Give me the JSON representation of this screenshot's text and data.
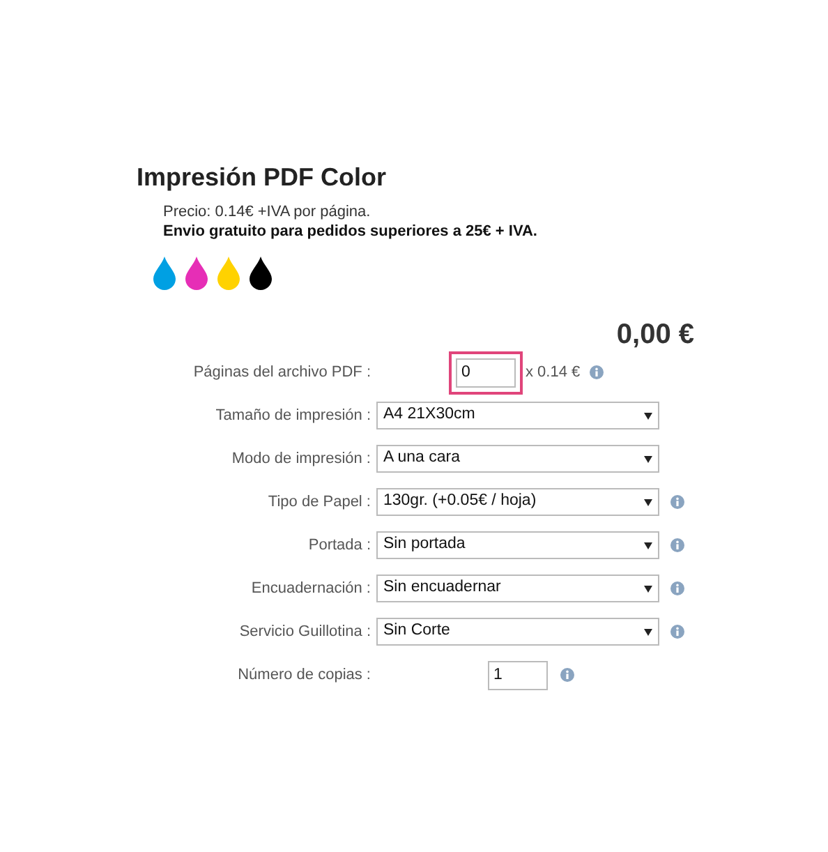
{
  "product": {
    "title": "Impresión PDF Color",
    "price_note": "Precio: 0.14€ +IVA por página.",
    "shipping_note": "Envio gratuito para pedidos superiores a 25€ + IVA.",
    "inks": [
      {
        "color": "#00a0e3"
      },
      {
        "color": "#e62eb6"
      },
      {
        "color": "#ffd200"
      },
      {
        "color": "#000000"
      }
    ]
  },
  "total": "0,00 €",
  "fields": [
    {
      "kind": "number",
      "label": "Páginas del archivo PDF :",
      "value": "0",
      "suffix": "x 0.14 €",
      "info": true,
      "focused": true
    },
    {
      "kind": "select",
      "label": "Tamaño de impresión :",
      "value": "A4 21X30cm",
      "info": false
    },
    {
      "kind": "select",
      "label": "Modo de impresión :",
      "value": "A una cara",
      "info": false
    },
    {
      "kind": "select",
      "label": "Tipo de Papel :",
      "value": "130gr. (+0.05€ / hoja)",
      "info": true
    },
    {
      "kind": "select",
      "label": "Portada :",
      "value": "Sin portada",
      "info": true
    },
    {
      "kind": "select",
      "label": "Encuadernación :",
      "value": "Sin encuadernar",
      "info": true
    },
    {
      "kind": "select",
      "label": "Servicio Guillotina :",
      "value": "Sin Corte",
      "info": true
    },
    {
      "kind": "number",
      "label": "Número de copias :",
      "value": "1",
      "info": true,
      "focused": false
    }
  ]
}
